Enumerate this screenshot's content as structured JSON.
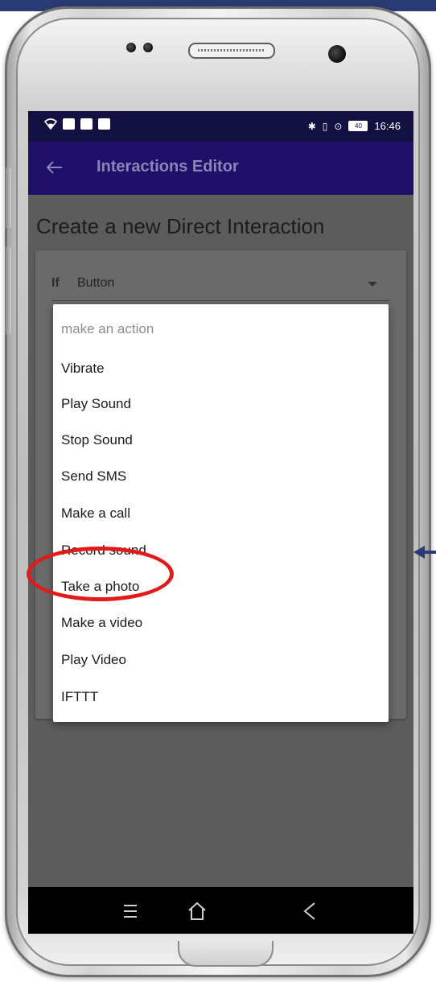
{
  "status_bar": {
    "time": "16:46",
    "battery": "40",
    "left_icons": [
      "wifi-icon",
      "image-icon",
      "gmail-icon",
      "gmail-icon"
    ],
    "right_icons": [
      "bluetooth-icon",
      "vibrate-icon",
      "location-icon",
      "battery-icon",
      "charging-icon"
    ]
  },
  "app_bar": {
    "title": "Interactions Editor",
    "back_icon": "arrow-left-icon"
  },
  "page": {
    "heading": "Create a new Direct Interaction",
    "if_label": "If",
    "if_value": "Button"
  },
  "menu": {
    "placeholder": "make an action",
    "items": [
      "Vibrate",
      "Play Sound",
      "Stop Sound",
      "Send SMS",
      "Make a call",
      "Record sound",
      "Take a photo",
      "Make a video",
      "Play Video",
      "IFTTT"
    ],
    "highlighted_item": "Take a photo"
  },
  "nav_bar": {
    "icons": [
      "menu-icon",
      "home-icon",
      "back-icon"
    ]
  },
  "colors": {
    "status_bar": "#131042",
    "app_bar": "#1f0f68",
    "title_text": "#8a86b8",
    "highlight": "#e11a1a",
    "annotation_arrow": "#2a3a72"
  }
}
